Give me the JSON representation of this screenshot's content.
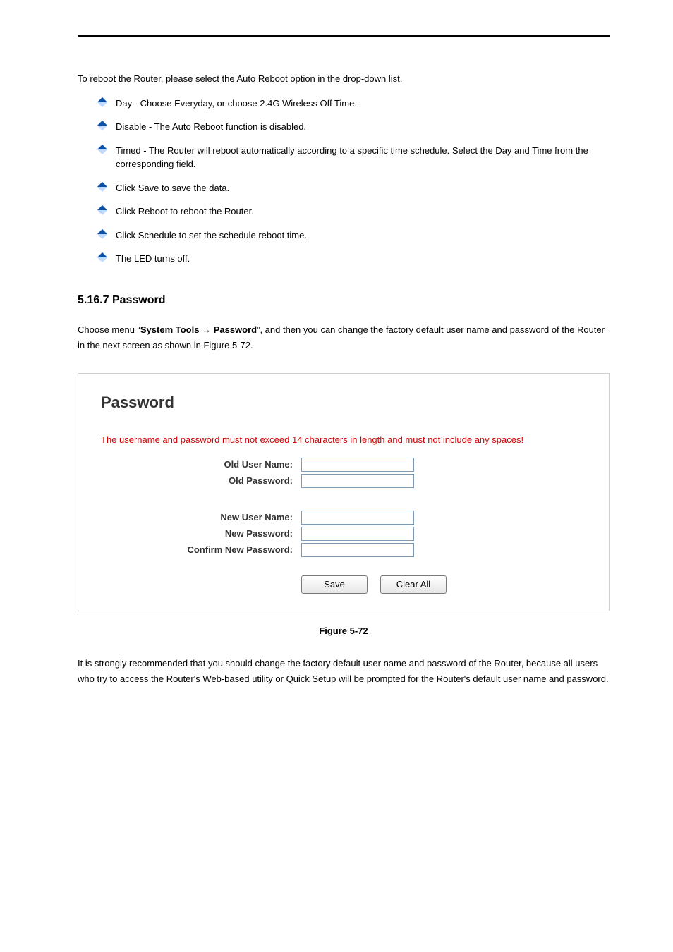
{
  "intro": "To reboot the Router, please select the Auto Reboot option in the drop-down list.",
  "bullets": [
    "Day - Choose Everyday, or choose 2.4G Wireless Off Time.",
    "Disable - The Auto Reboot function is disabled.",
    "Timed - The Router will reboot automatically according to a specific time schedule. Select the Day and Time from the corresponding field.",
    "Click Save to save the data.",
    "Click Reboot to reboot the Router.",
    "Click Schedule to set the schedule reboot time.",
    "The LED turns off."
  ],
  "section": {
    "number": "5.16.7",
    "title": "Password",
    "body_prefix": "Choose menu “",
    "breadcrumb_1": "System Tools",
    "arrow": " → ",
    "breadcrumb_2": "Password",
    "body_suffix": "”, and then you can change the factory default user name and password of the Router in the next screen as shown in Figure 5-72."
  },
  "panel": {
    "title": "Password",
    "warning": "The username and password must not exceed 14 characters in length and must not include any spaces!",
    "labels": {
      "old_user": "Old User Name:",
      "old_pass": "Old Password:",
      "new_user": "New User Name:",
      "new_pass": "New Password:",
      "confirm": "Confirm New Password:"
    },
    "buttons": {
      "save": "Save",
      "clear": "Clear All"
    }
  },
  "caption": "Figure 5-72",
  "tail": "It is strongly recommended that you should change the factory default user name and password of the Router, because all users who try to access the Router's Web-based utility or Quick Setup will be prompted for the Router's default user name and password."
}
